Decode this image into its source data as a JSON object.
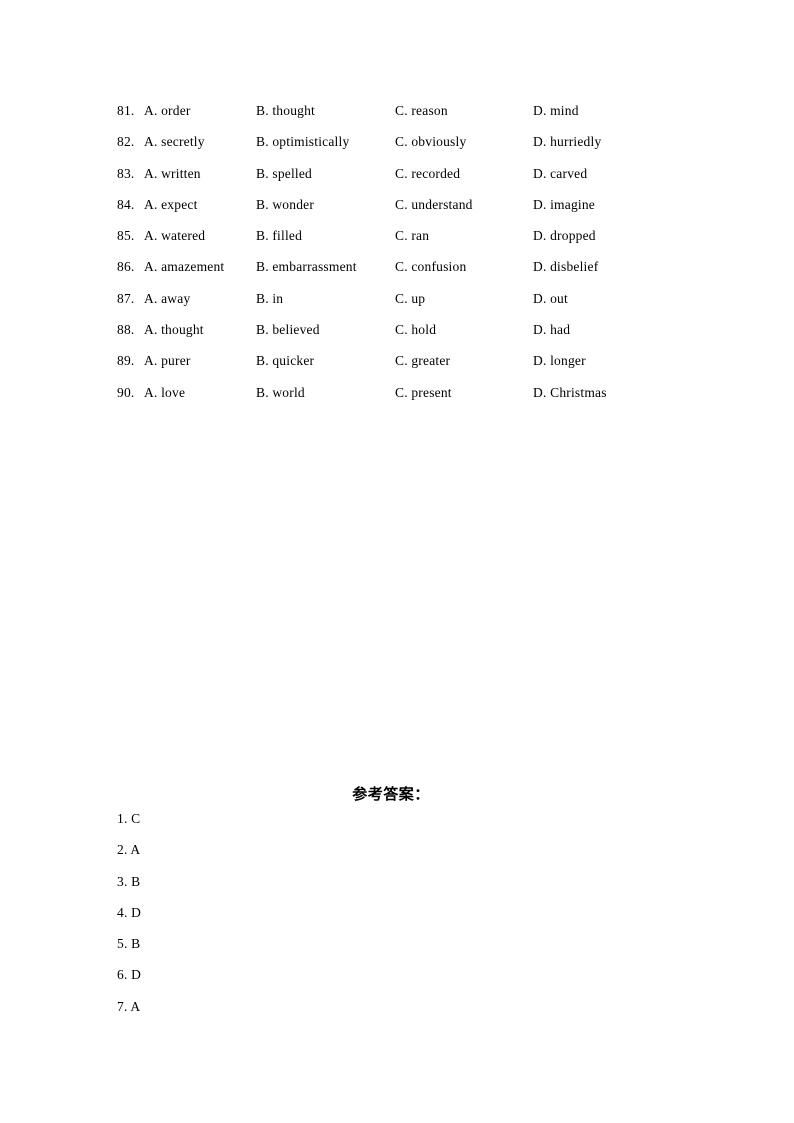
{
  "document": {
    "background_color": "#ffffff",
    "text_color": "#000000"
  },
  "questions": {
    "option_labels": [
      "A.",
      "B.",
      "C.",
      "D."
    ],
    "rows": [
      {
        "number": "81.",
        "a": "order",
        "b": "thought",
        "c": "reason",
        "d": "mind"
      },
      {
        "number": "82.",
        "a": "secretly",
        "b": "optimistically",
        "c": "obviously",
        "d": "hurriedly"
      },
      {
        "number": "83.",
        "a": "written",
        "b": "spelled",
        "c": "recorded",
        "d": "carved"
      },
      {
        "number": "84.",
        "a": "expect",
        "b": "wonder",
        "c": "understand",
        "d": "imagine"
      },
      {
        "number": "85.",
        "a": "watered",
        "b": "filled",
        "c": "ran",
        "d": "dropped"
      },
      {
        "number": "86.",
        "a": "amazement",
        "b": "embarrassment",
        "c": "confusion",
        "d": "disbelief"
      },
      {
        "number": "87.",
        "a": "away",
        "b": "in",
        "c": "up",
        "d": "out"
      },
      {
        "number": "88.",
        "a": "thought",
        "b": "believed",
        "c": "hold",
        "d": "had"
      },
      {
        "number": "89.",
        "a": "purer",
        "b": "quicker",
        "c": "greater",
        "d": "longer"
      },
      {
        "number": "90.",
        "a": "love",
        "b": "world",
        "c": "present",
        "d": "Christmas"
      }
    ]
  },
  "answer_key": {
    "heading": "参考答案：",
    "items": [
      {
        "text": "1. C"
      },
      {
        "text": "2. A"
      },
      {
        "text": "3. B"
      },
      {
        "text": "4. D"
      },
      {
        "text": "5. B"
      },
      {
        "text": "6. D"
      },
      {
        "text": "7. A"
      }
    ]
  }
}
